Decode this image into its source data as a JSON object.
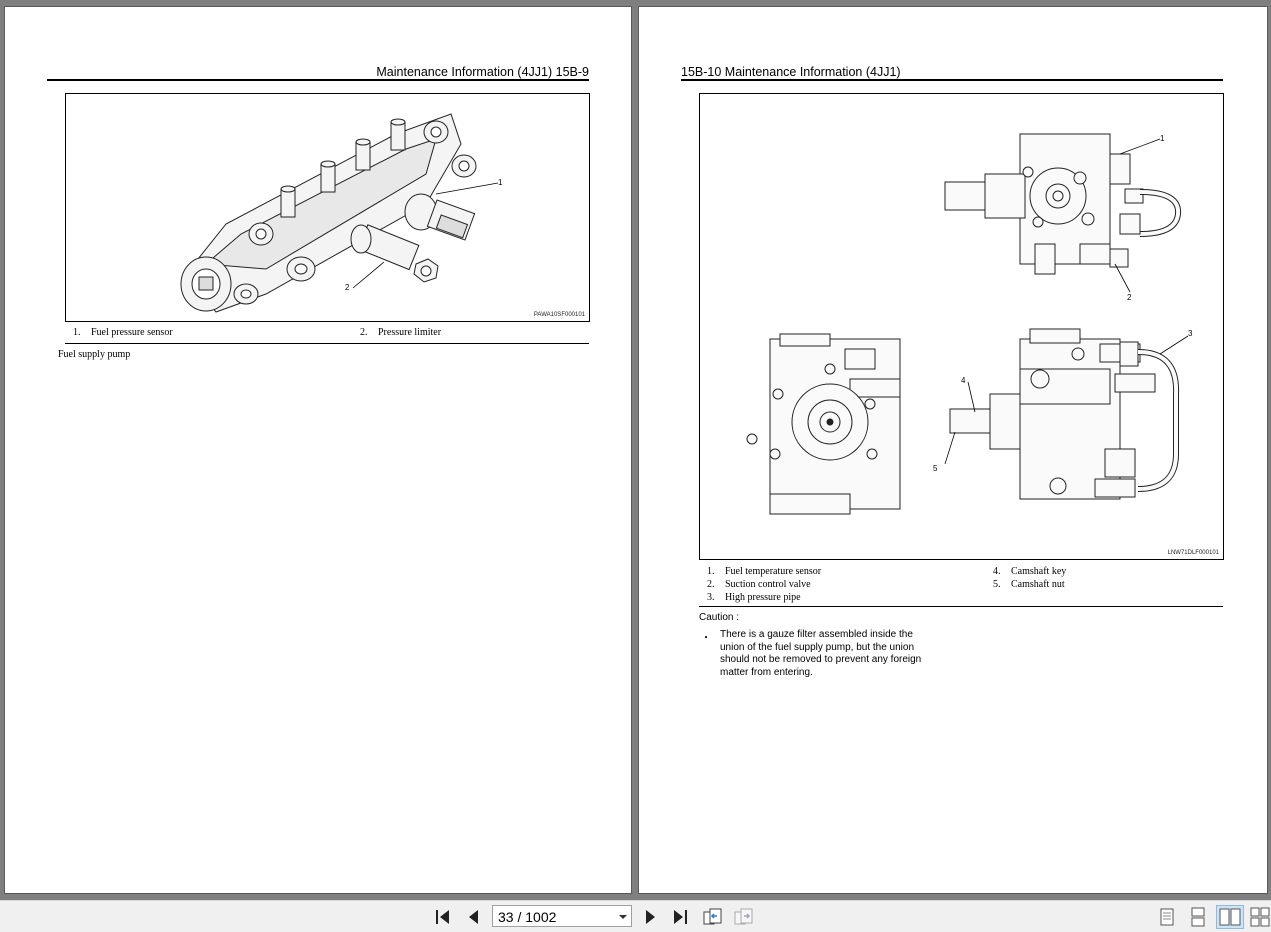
{
  "left_page": {
    "header": "Maintenance Information (4JJ1)   15B-9",
    "figure": {
      "code": "PAWA10SF000101",
      "callouts": [
        "1",
        "2"
      ]
    },
    "legend": [
      {
        "num": "1.",
        "label": "Fuel pressure sensor"
      },
      {
        "num": "2.",
        "label": "Pressure limiter"
      }
    ],
    "body": "Fuel supply pump"
  },
  "right_page": {
    "header": "15B-10   Maintenance Information (4JJ1)",
    "figure": {
      "code": "LNW71DLF000101",
      "callouts": [
        "1",
        "2",
        "3",
        "4",
        "5"
      ]
    },
    "legend": [
      {
        "num": "1.",
        "label": "Fuel temperature sensor"
      },
      {
        "num": "2.",
        "label": "Suction control valve"
      },
      {
        "num": "3.",
        "label": "High pressure pipe"
      },
      {
        "num": "4.",
        "label": "Camshaft key"
      },
      {
        "num": "5.",
        "label": "Camshaft nut"
      }
    ],
    "caution": {
      "title": "Caution :",
      "bullet": "・",
      "text": "There is a gauze filter assembled inside the union of the fuel supply pump, but the union should not be removed to prevent any foreign matter from entering."
    }
  },
  "toolbar": {
    "page_indicator": "33 / 1002",
    "icons": [
      "first-page-icon",
      "prev-page-icon",
      "next-page-icon",
      "last-page-icon",
      "go-back-view-icon",
      "go-forward-view-icon",
      "single-page-view-icon",
      "continuous-view-icon",
      "facing-view-icon",
      "continuous-facing-view-icon"
    ]
  }
}
